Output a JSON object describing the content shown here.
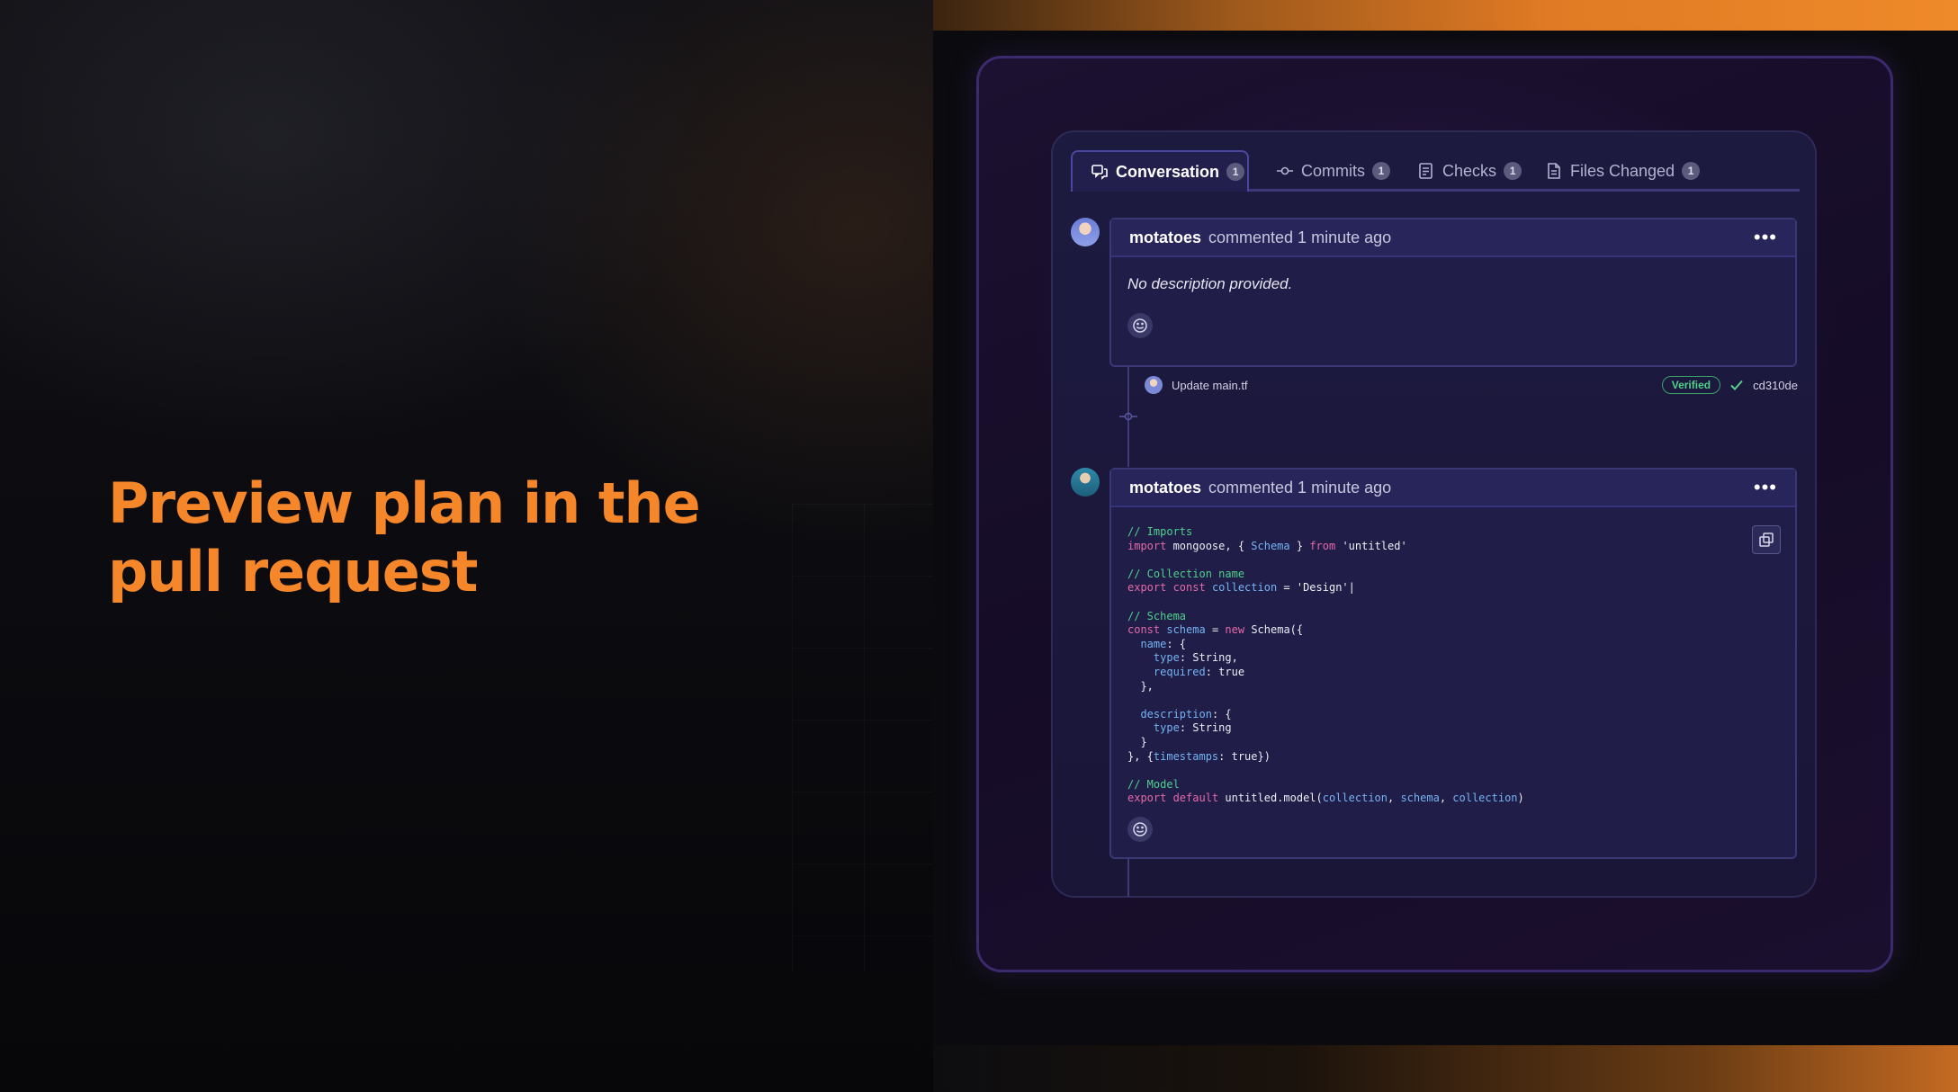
{
  "hero": {
    "title_line1": "Preview plan in the",
    "title_line2": "pull request"
  },
  "tabs": [
    {
      "label": "Conversation",
      "count": "1",
      "icon": "comment-icon"
    },
    {
      "label": "Commits",
      "count": "1",
      "icon": "commit-icon"
    },
    {
      "label": "Checks",
      "count": "1",
      "icon": "checklist-icon"
    },
    {
      "label": "Files Changed",
      "count": "1",
      "icon": "file-icon"
    }
  ],
  "comments": [
    {
      "author": "motatoes",
      "meta": "commented 1 minute ago",
      "body": "No description provided."
    },
    {
      "author": "motatoes",
      "meta": "commented 1 minute ago"
    }
  ],
  "commit": {
    "message": "Update main.tf",
    "status": "Verified",
    "sha": "cd310de"
  },
  "code": {
    "c1": "// Imports",
    "l1a": "import",
    "l1b": " mongoose, { ",
    "l1c": "Schema",
    "l1d": " } ",
    "l1e": "from",
    "l1f": " 'untitled'",
    "c2": "// Collection name",
    "l2a": "export const",
    "l2b": "collection",
    "l2c": " = 'Design'|",
    "c3": "// Schema",
    "l3a": "const",
    "l3b": "schema",
    "l3c": " = ",
    "l3d": "new",
    "l3e": " Schema({",
    "l4": "name",
    "l4b": ": {",
    "l5": "type",
    "l5b": ": String,",
    "l6": "required",
    "l6b": ": true",
    "l7": "},",
    "l8": "description",
    "l8b": ": {",
    "l9": "type",
    "l9b": ": String",
    "l10": "}",
    "l11a": "}, {",
    "l11b": "timestamps",
    "l11c": ": true})",
    "c4": "// Model",
    "l12a": "export default",
    "l12b": " untitled.model(",
    "l12c": "collection",
    "l12d": ", ",
    "l12e": "schema",
    "l12f": ", ",
    "l12g": "collection",
    "l12h": ")"
  },
  "colors": {
    "accent_orange": "#f5862a",
    "verified_green": "#52d08a",
    "panel_bg": "#1d1a40"
  }
}
